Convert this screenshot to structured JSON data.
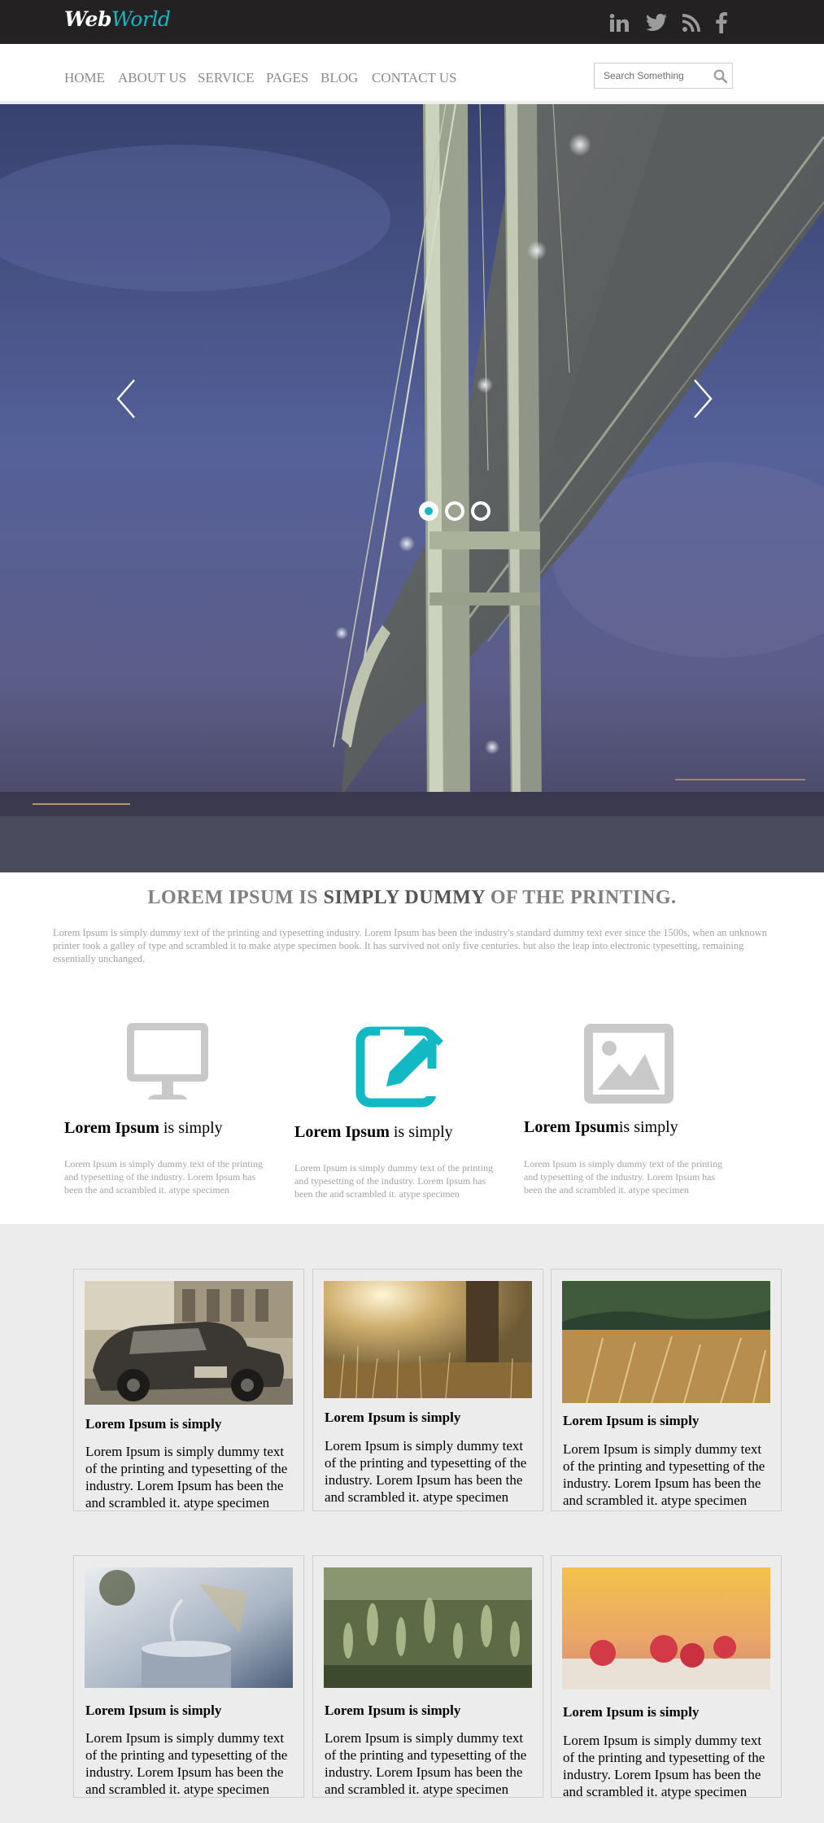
{
  "brand": {
    "part1": "Web",
    "part2": "World"
  },
  "social": [
    {
      "name": "linkedin-icon"
    },
    {
      "name": "twitter-icon"
    },
    {
      "name": "rss-icon"
    },
    {
      "name": "facebook-icon"
    }
  ],
  "nav": {
    "items": [
      "HOME",
      "ABOUT US",
      "SERVICE",
      "PAGES",
      "BLOG",
      "CONTACT US"
    ],
    "search_placeholder": "Search Something"
  },
  "hero": {
    "slides": 3,
    "active_slide": 1,
    "icons": {
      "prev": "chevron-left-icon",
      "next": "chevron-right-icon"
    }
  },
  "intro": {
    "title_part1": "LOREM IPSUM IS ",
    "title_part2": "SIMPLY DUMMY",
    "title_part3": " OF THE PRINTING.",
    "text": "Lorem Ipsum is simply dummy text of the printing and typesetting industry. Lorem Ipsum has been the industry's standard dummy text ever since the 1500s, when an unknown printer took a galley of type and scrambled it to make atype specimen book. It has survived not only five centuries. but also the leap into electronic typesetting, remaining essentially unchanged."
  },
  "features": [
    {
      "icon": "monitor-icon",
      "title_bold": "Lorem Ipsum",
      "title_rest": " is simply",
      "text": "Lorem Ipsum is simply dummy text of the printing and typesetting of the industry. Lorem Ipsum has been the and scrambled it. atype specimen",
      "color": "#c9c9c9"
    },
    {
      "icon": "edit-icon",
      "title_bold": "Lorem Ipsum",
      "title_rest": " is simply",
      "text": "Lorem Ipsum is simply dummy text of the printing and typesetting of the industry. Lorem Ipsum has been the and scrambled it. atype specimen",
      "color": "#12b8c4"
    },
    {
      "icon": "image-icon",
      "title_bold": "Lorem Ipsum",
      "title_rest": "is simply",
      "text": "Lorem Ipsum is simply dummy text of the printing and typesetting of the industry. Lorem Ipsum has been the and scrambled it. atype specimen",
      "color": "#c9c9c9"
    }
  ],
  "cards": [
    {
      "image": "vintage-car-photo",
      "title": "Lorem Ipsum is simply",
      "text": "Lorem Ipsum is simply dummy text of the printing and typesetting of the industry. Lorem Ipsum has been the and scrambled it. atype specimen"
    },
    {
      "image": "sunlit-field-photo",
      "title": "Lorem Ipsum is simply",
      "text": "Lorem Ipsum is simply dummy text of the printing and typesetting of the industry. Lorem Ipsum has been the and scrambled it. atype specimen"
    },
    {
      "image": "wheat-field-photo",
      "title": "Lorem Ipsum is simply",
      "text": "Lorem Ipsum is simply dummy text of the printing and typesetting of the industry. Lorem Ipsum has been the and scrambled it. atype specimen"
    },
    {
      "image": "steaming-cup-photo",
      "title": "Lorem Ipsum is simply",
      "text": "Lorem Ipsum is simply dummy text of the printing and typesetting of the industry. Lorem Ipsum has been the and scrambled it. atype specimen"
    },
    {
      "image": "green-wheat-photo",
      "title": "Lorem Ipsum is simply",
      "text": "Lorem Ipsum is simply dummy text of the printing and typesetting of the industry. Lorem Ipsum has been the and scrambled it. atype specimen"
    },
    {
      "image": "raspberries-photo",
      "title": "Lorem Ipsum is simply",
      "text": "Lorem Ipsum is simply dummy text of the printing and typesetting of the industry. Lorem Ipsum has been the and scrambled it. atype specimen"
    }
  ],
  "colors": {
    "accent": "#12b8c4",
    "topbar": "#232122",
    "gallery_bg": "#ececec"
  }
}
